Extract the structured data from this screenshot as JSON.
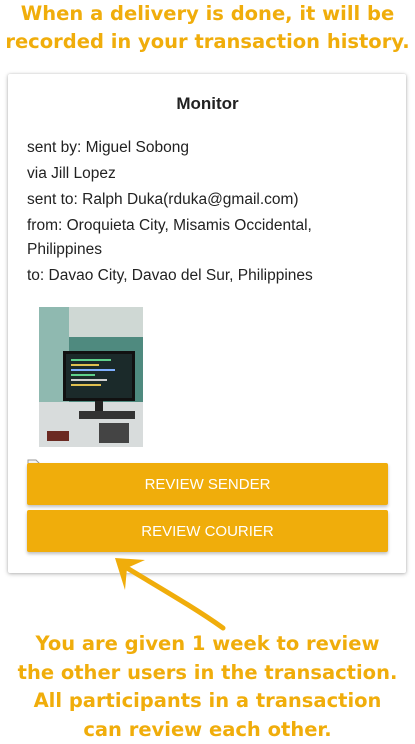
{
  "top_caption": [
    "When a delivery is done, it will be",
    "recorded in your transaction history."
  ],
  "card": {
    "title": "Monitor",
    "sent_by": "sent by: Miguel Sobong",
    "via": "via Jill Lopez",
    "sent_to": "sent to: Ralph Duka(rduka@gmail.com)",
    "from": "from: Oroquieta City, Misamis Occidental, Philippines",
    "to": "to: Davao City, Davao del Sur, Philippines",
    "review_sender_label": "REVIEW SENDER",
    "review_courier_label": "REVIEW COURIER"
  },
  "bottom_caption": [
    "You are given 1 week to review",
    "the other users in the transaction.",
    "All participants in a transaction",
    "can review each other."
  ],
  "colors": {
    "accent": "#f0ad0b",
    "text": "#222222"
  },
  "icons": {
    "pointer_arrow": "arrow-up-left-icon",
    "broken_image": "broken-image-icon"
  }
}
